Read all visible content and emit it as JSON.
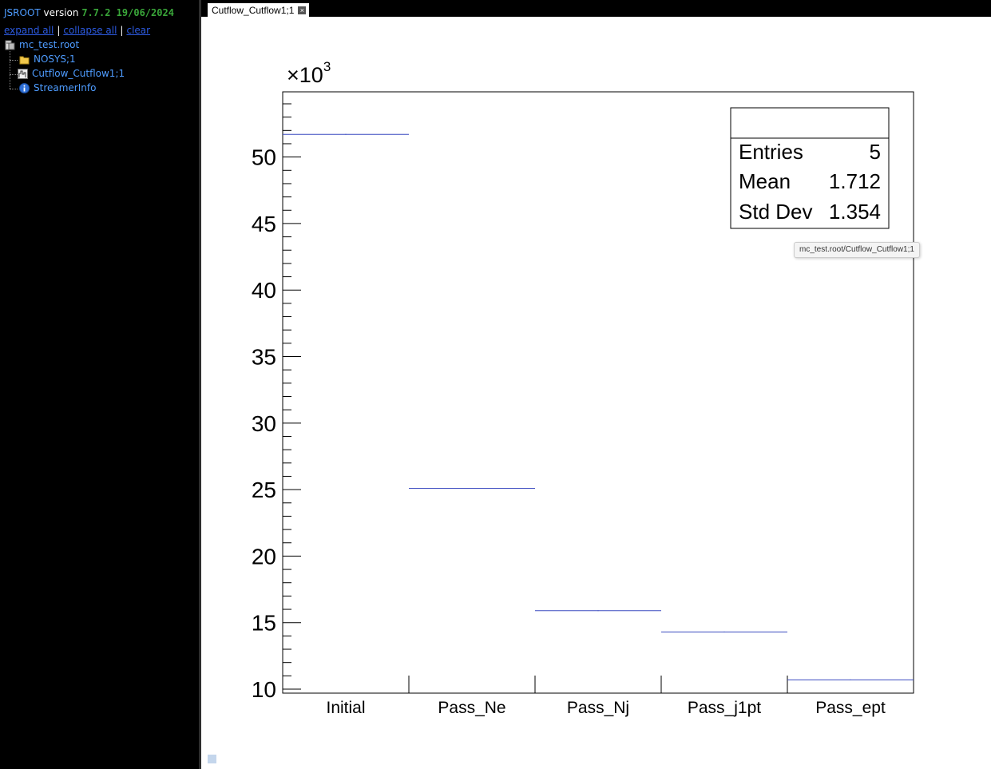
{
  "sidebar": {
    "app_name": "JSROOT",
    "version_word": "version",
    "version_number": "7.7.2 19/06/2024",
    "links": [
      "expand all",
      "collapse all",
      "clear"
    ],
    "link_separator": "|",
    "tree": [
      {
        "label": "mc_test.root",
        "icon": "root-file-icon"
      },
      {
        "label": "NOSYS;1",
        "icon": "folder-icon"
      },
      {
        "label": "Cutflow_Cutflow1;1",
        "icon": "histogram-icon"
      },
      {
        "label": "StreamerInfo",
        "icon": "info-icon"
      }
    ]
  },
  "tab": {
    "label": "Cutflow_Cutflow1;1",
    "close_glyph": "×"
  },
  "tooltip": "mc_test.root/Cutflow_Cutflow1;1",
  "stats": {
    "rows": [
      {
        "name": "Entries",
        "value": "5"
      },
      {
        "name": "Mean",
        "value": "1.712"
      },
      {
        "name": "Std Dev",
        "value": "1.354"
      }
    ]
  },
  "colors": {
    "histogram_line": "#3b4cc0",
    "sidebar_bg": "#000000",
    "link": "#2c5ae0",
    "tree_text": "#4e9cff",
    "version_number": "#3aa63a"
  },
  "chart_data": {
    "type": "bar",
    "style": "histogram-step",
    "title": "",
    "xlabel": "",
    "ylabel": "",
    "y_exponent_label": "×10",
    "y_exponent_power": "3",
    "categories": [
      "Initial",
      "Pass_Ne",
      "Pass_Nj",
      "Pass_j1pt",
      "Pass_ept"
    ],
    "values": [
      51.7,
      25.1,
      15.9,
      14.3,
      10.7
    ],
    "ylim": [
      9.7,
      54.9
    ],
    "yticks": [
      10,
      15,
      20,
      25,
      30,
      35,
      40,
      45,
      50
    ],
    "ytick_labels": [
      "10",
      "15",
      "20",
      "25",
      "30",
      "35",
      "40",
      "45",
      "50"
    ],
    "minor_tick_step": 1,
    "grid": false,
    "legend": "none",
    "stats_box_position": "top-right"
  }
}
